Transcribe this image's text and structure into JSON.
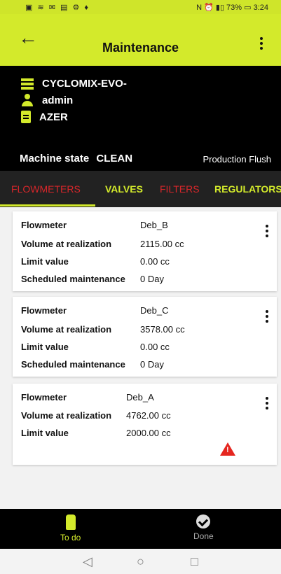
{
  "status_bar": {
    "left_icons": "▣ ≋ ✉ ▤ ⚙ ♦",
    "right": "N ⏰ ▮▯ 73% ▭ 3:24"
  },
  "app_bar": {
    "title": "Maintenance"
  },
  "machine": {
    "name": "CYCLOMIX-EVO-",
    "user": "admin",
    "code": "AZER",
    "state_label": "Machine state",
    "state_value": "CLEAN",
    "mode": "Production Flush"
  },
  "tabs": [
    "FLOWMETERS",
    "VALVES",
    "FILTERS",
    "REGULATORS"
  ],
  "cards": [
    {
      "rows": [
        {
          "label": "Flowmeter",
          "value": "Deb_B"
        },
        {
          "label": "Volume at realization",
          "value": "2115.00 cc"
        },
        {
          "label": "Limit value",
          "value": "0.00 cc"
        },
        {
          "label": "Scheduled maintenance",
          "value": "0 Day"
        }
      ]
    },
    {
      "rows": [
        {
          "label": "Flowmeter",
          "value": "Deb_C"
        },
        {
          "label": "Volume at realization",
          "value": "3578.00 cc"
        },
        {
          "label": "Limit value",
          "value": "0.00 cc"
        },
        {
          "label": "Scheduled maintenance",
          "value": "0 Day"
        }
      ]
    },
    {
      "rows": [
        {
          "label": "Flowmeter",
          "value": "Deb_A"
        },
        {
          "label": "Volume at realization",
          "value": "4762.00 cc"
        },
        {
          "label": "Limit value",
          "value": "2000.00 cc"
        }
      ],
      "warning_icon": "warning-triangle-icon"
    }
  ],
  "bottom_nav": {
    "todo": "To do",
    "done": "Done"
  },
  "colors": {
    "accent": "#d3ea2b",
    "alert": "#d8262a",
    "dark": "#000000"
  }
}
